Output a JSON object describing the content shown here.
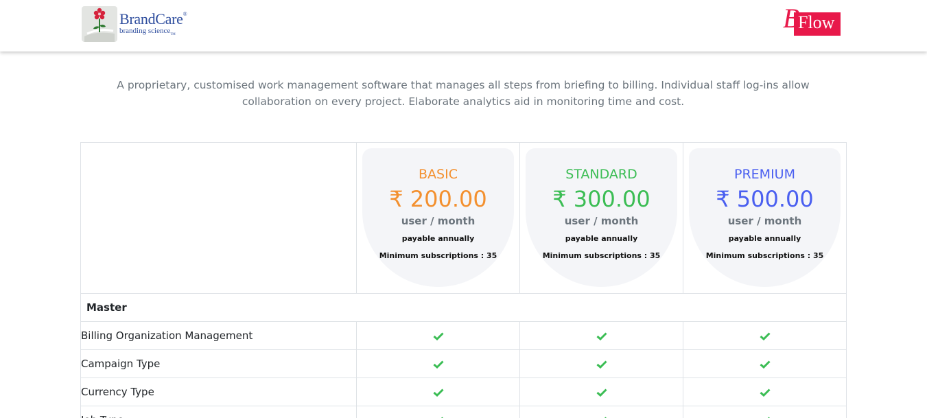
{
  "header": {
    "brand_name": "BrandCare",
    "brand_tagline": "branding science",
    "product_logo_b": "B",
    "product_logo_word": "Flow"
  },
  "intro": "A proprietary, customised work management software that manages all steps from briefing to billing. Individual staff log-ins allow collaboration on every project. Elaborate analytics aid in monitoring time and cost.",
  "plans": [
    {
      "name": "BASIC",
      "price": "₹ 200.00",
      "unit": "user / month",
      "billing": "payable annually",
      "minimum": "Minimum subscriptions : 35",
      "color": "#f3902f"
    },
    {
      "name": "STANDARD",
      "price": "₹ 300.00",
      "unit": "user / month",
      "billing": "payable annually",
      "minimum": "Minimum subscriptions : 35",
      "color": "#3bbd54"
    },
    {
      "name": "PREMIUM",
      "price": "₹ 500.00",
      "unit": "user / month",
      "billing": "payable annually",
      "minimum": "Minimum subscriptions : 35",
      "color": "#4a5ff0"
    }
  ],
  "section": {
    "title": "Master"
  },
  "features": [
    {
      "name": "Billing Organization Management",
      "basic": true,
      "standard": true,
      "premium": true
    },
    {
      "name": "Campaign Type",
      "basic": true,
      "standard": true,
      "premium": true
    },
    {
      "name": "Currency Type",
      "basic": true,
      "standard": true,
      "premium": true
    },
    {
      "name": "Job Type",
      "basic": true,
      "standard": true,
      "premium": true
    }
  ],
  "icons": {
    "check": "check-icon",
    "check_color": "#3bbd54"
  }
}
